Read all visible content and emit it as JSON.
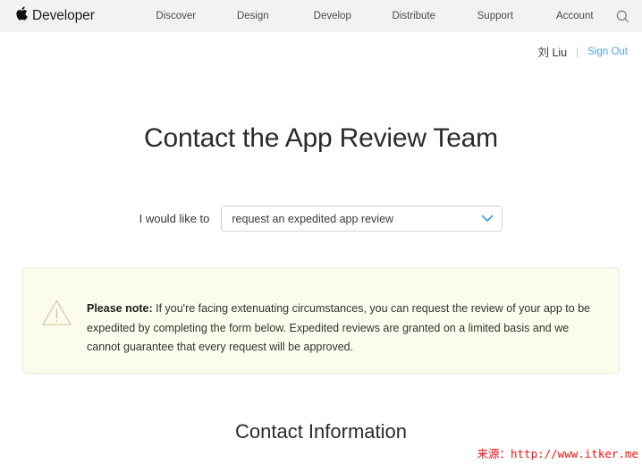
{
  "navbar": {
    "brand": {
      "logo_icon": "apple-logo-icon",
      "logo_glyph": "",
      "label": "Developer"
    },
    "links": [
      {
        "label": "Discover"
      },
      {
        "label": "Design"
      },
      {
        "label": "Develop"
      },
      {
        "label": "Distribute"
      },
      {
        "label": "Support"
      },
      {
        "label": "Account"
      }
    ],
    "search_icon": "search-icon"
  },
  "account": {
    "user_name": "刘 Liu",
    "separator": "|",
    "sign_out_label": "Sign Out",
    "sign_out_color": "#4da2e8"
  },
  "main": {
    "page_title": "Contact the App Review Team",
    "select_label": "I would like to",
    "select_value": "request an expedited app review",
    "select_chevron_icon": "chevron-down-icon",
    "select_chevron_color": "#3e9fe0",
    "notice": {
      "icon": "warning-triangle-icon",
      "icon_color": "#cdc49a",
      "background_color": "#fbfbee",
      "border_color": "#ece8d2",
      "strong_label": "Please note:",
      "body": " If you're facing extenuating circumstances, you can request the review of your app to be expedited by completing the form below. Expedited reviews are granted on a limited basis and we cannot guarantee that every request will be approved."
    },
    "contact_info_title": "Contact Information"
  },
  "watermark": {
    "text": "来源：http://www.itker.me",
    "color": "#ee1111"
  }
}
